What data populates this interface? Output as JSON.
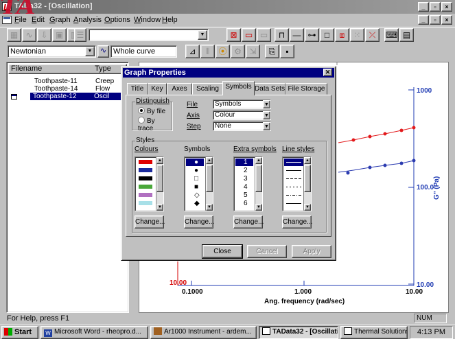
{
  "window": {
    "title": "TADa32 - [Oscillation]",
    "logo_text": "TA"
  },
  "menu": [
    {
      "label": "File",
      "key": "F"
    },
    {
      "label": "Edit",
      "key": "E"
    },
    {
      "label": "Graph",
      "key": "G"
    },
    {
      "label": "Analysis",
      "key": "A"
    },
    {
      "label": "Options",
      "key": "O"
    },
    {
      "label": "Window",
      "key": "W"
    },
    {
      "label": "Help",
      "key": "H"
    }
  ],
  "toolbar2": {
    "model": "Newtonian",
    "range": "Whole curve"
  },
  "file_list": {
    "headers": [
      "Filename",
      "Type"
    ],
    "rows": [
      {
        "filename": "Toothpaste-11",
        "type": "Creep"
      },
      {
        "filename": "Toothpaste-14",
        "type": "Flow"
      },
      {
        "filename": "Toothpaste-12",
        "type": "Oscil",
        "selected": true
      }
    ]
  },
  "graph": {
    "y_tick_labels": [
      "1000",
      "100.0",
      "10.00"
    ],
    "y_axis_label": "G'' (Pa)",
    "left_axis_tick": "10.00",
    "x_tick_labels": [
      "0.1000",
      "1.000",
      "10.00"
    ],
    "x_axis_label": "Ang. frequency (rad/sec)",
    "colors": {
      "red_series": "#e31a1c",
      "blue_series": "#2b3bb0",
      "axis_blue": "#1f3bb3",
      "axis_red": "#d40000"
    }
  },
  "dialog": {
    "title": "Graph Properties",
    "close_glyph": "✕",
    "tabs": [
      "Title",
      "Key",
      "Axes",
      "Scaling",
      "Symbols",
      "Data Sets",
      "File Storage"
    ],
    "active_tab": "Symbols",
    "distinguish": {
      "label": "Distinguish",
      "options": [
        "By file",
        "By trace"
      ],
      "selected": "By file"
    },
    "fields": [
      {
        "label": "File",
        "value": "Symbols"
      },
      {
        "label": "Axis",
        "value": "Colour"
      },
      {
        "label": "Step",
        "value": "None"
      }
    ],
    "styles": {
      "label": "Styles",
      "colours_header": "Colours",
      "symbols_header": "Symbols",
      "extra_header": "Extra symbols",
      "line_header": "Line styles",
      "colours": [
        "#e00000",
        "#1a2a9c",
        "#000000",
        "#4aa83a",
        "#b070c0",
        "#a8e0e8"
      ],
      "symbols": [
        "●",
        "●",
        "□",
        "■",
        "◇",
        "◆"
      ],
      "extra_symbols": [
        "1",
        "2",
        "3",
        "4",
        "5",
        "6"
      ],
      "change_label": "Change..."
    },
    "buttons": {
      "close": "Close",
      "cancel": "Cancel",
      "apply": "Apply"
    }
  },
  "statusbar": {
    "message": "For Help, press F1",
    "num": "NUM"
  },
  "taskbar": {
    "start": "Start",
    "tasks": [
      {
        "label": "Microsoft Word - rheopro.d...",
        "icon": "word-icon",
        "active": false
      },
      {
        "label": "Ar1000 Instrument - ardem...",
        "icon": "instrument-icon",
        "active": false
      },
      {
        "label": "TAData32 - [Oscillati...",
        "icon": "tadata-icon",
        "active": true
      },
      {
        "label": "Thermal Solutions",
        "icon": "ta-icon",
        "active": false
      }
    ],
    "clock": "4:13 PM"
  }
}
